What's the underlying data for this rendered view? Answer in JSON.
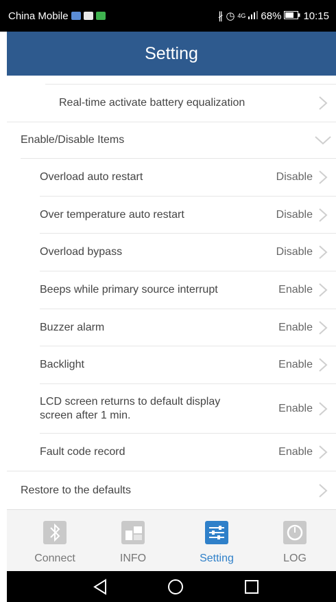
{
  "status_bar": {
    "carrier": "China Mobile",
    "network": "4G",
    "battery": "68%",
    "time": "10:15"
  },
  "header": {
    "title": "Setting"
  },
  "items": {
    "battery_equalization": {
      "label": "Real-time activate battery equalization"
    },
    "section_enable_disable": {
      "label": "Enable/Disable Items"
    },
    "overload_auto_restart": {
      "label": "Overload auto restart",
      "value": "Disable"
    },
    "over_temp_auto_restart": {
      "label": "Over temperature auto restart",
      "value": "Disable"
    },
    "overload_bypass": {
      "label": "Overload bypass",
      "value": "Disable"
    },
    "beeps_interrupt": {
      "label": "Beeps while primary source interrupt",
      "value": "Enable"
    },
    "buzzer_alarm": {
      "label": "Buzzer alarm",
      "value": "Enable"
    },
    "backlight": {
      "label": "Backlight",
      "value": "Enable"
    },
    "lcd_return": {
      "label_line1": "LCD screen returns to default display",
      "label_line2": "screen after 1 min.",
      "value": "Enable"
    },
    "fault_code_record": {
      "label": "Fault code record",
      "value": "Enable"
    },
    "restore_defaults": {
      "label": "Restore to the defaults"
    }
  },
  "bottom_nav": {
    "connect": "Connect",
    "info": "INFO",
    "setting": "Setting",
    "log": "LOG"
  },
  "colors": {
    "header": "#2e5a8e",
    "active_tab": "#2f80c9",
    "inactive_icon": "#c9c9c9"
  }
}
